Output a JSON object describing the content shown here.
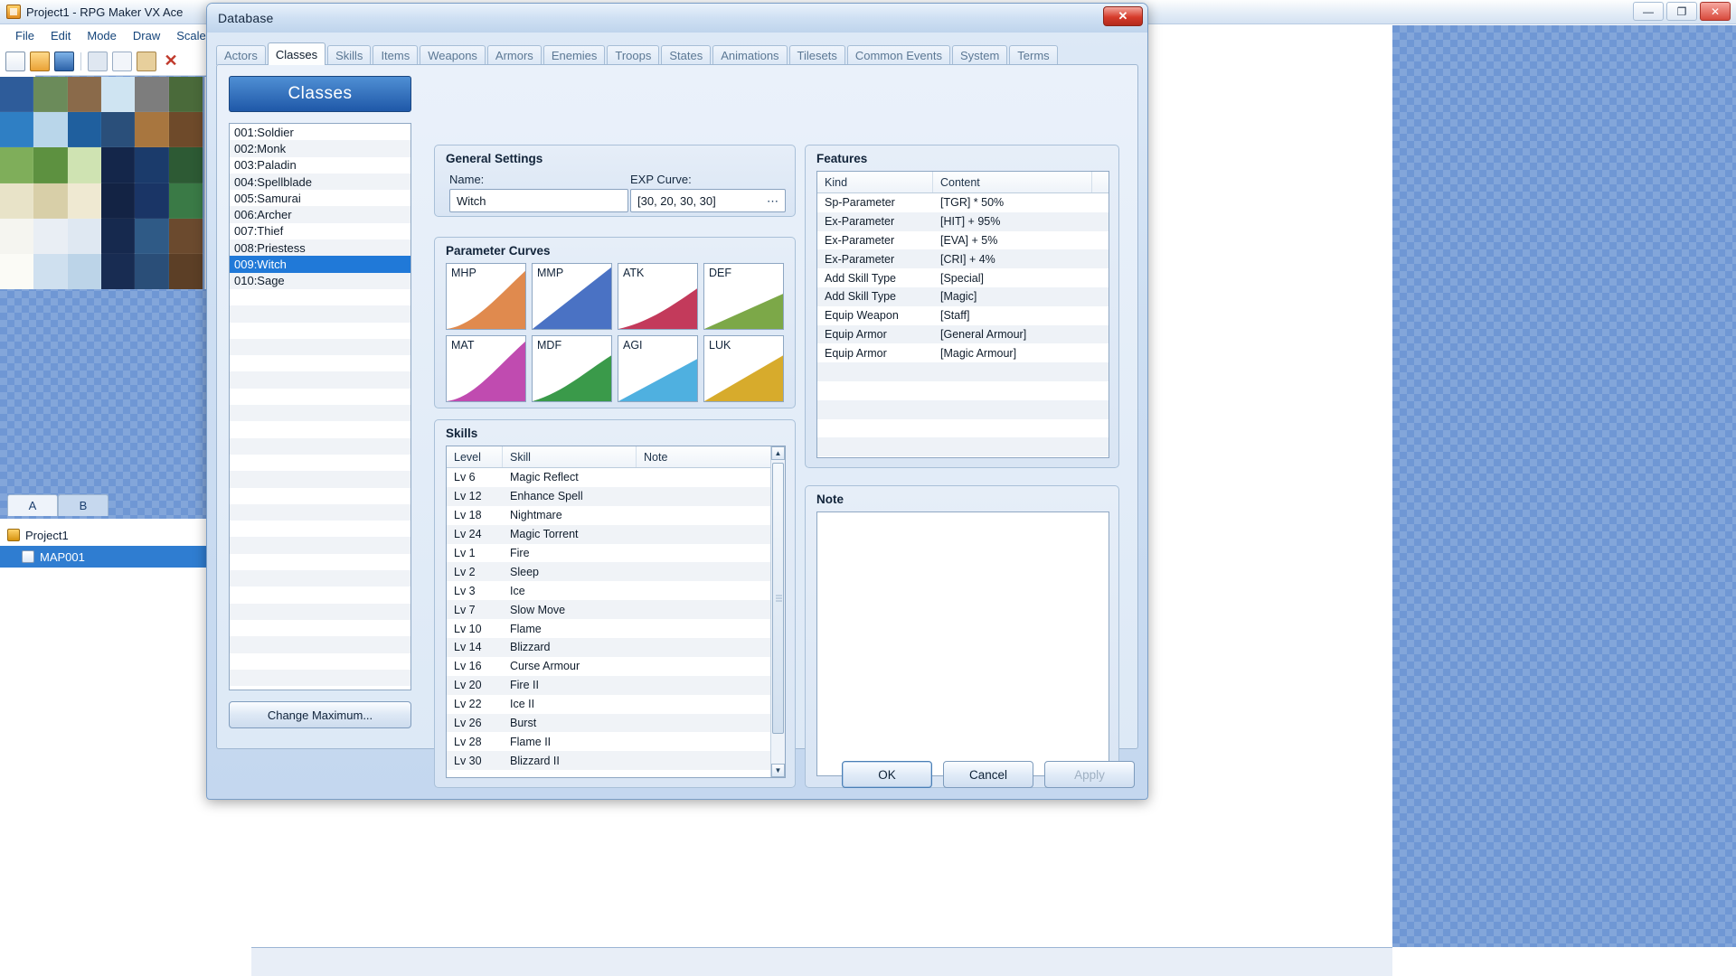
{
  "editor": {
    "title": "Project1 - RPG Maker VX Ace",
    "menu": [
      "File",
      "Edit",
      "Mode",
      "Draw",
      "Scale"
    ],
    "window_buttons": {
      "minimize": "—",
      "maximize": "❐",
      "close": "✕"
    },
    "layer_tabs": [
      {
        "label": "A",
        "active": false
      },
      {
        "label": "B",
        "active": true
      }
    ],
    "tree": [
      {
        "label": "Project1",
        "icon": "project-icon",
        "selected": false,
        "indent": false
      },
      {
        "label": "MAP001",
        "icon": "map-icon",
        "selected": true,
        "indent": true
      }
    ]
  },
  "dialog": {
    "title": "Database",
    "close_label": "✕",
    "tabs": [
      {
        "label": "Actors",
        "active": false
      },
      {
        "label": "Classes",
        "active": true
      },
      {
        "label": "Skills",
        "active": false
      },
      {
        "label": "Items",
        "active": false
      },
      {
        "label": "Weapons",
        "active": false
      },
      {
        "label": "Armors",
        "active": false
      },
      {
        "label": "Enemies",
        "active": false
      },
      {
        "label": "Troops",
        "active": false
      },
      {
        "label": "States",
        "active": false
      },
      {
        "label": "Animations",
        "active": false
      },
      {
        "label": "Tilesets",
        "active": false
      },
      {
        "label": "Common Events",
        "active": false
      },
      {
        "label": "System",
        "active": false
      },
      {
        "label": "Terms",
        "active": false
      }
    ],
    "buttons": {
      "ok": "OK",
      "cancel": "Cancel",
      "apply": "Apply"
    }
  },
  "classes_panel": {
    "header": "Classes",
    "change_maximum": "Change Maximum...",
    "items": [
      {
        "label": "001:Soldier",
        "selected": false
      },
      {
        "label": "002:Monk",
        "selected": false
      },
      {
        "label": "003:Paladin",
        "selected": false
      },
      {
        "label": "004:Spellblade",
        "selected": false
      },
      {
        "label": "005:Samurai",
        "selected": false
      },
      {
        "label": "006:Archer",
        "selected": false
      },
      {
        "label": "007:Thief",
        "selected": false
      },
      {
        "label": "008:Priestess",
        "selected": false
      },
      {
        "label": "009:Witch",
        "selected": true
      },
      {
        "label": "010:Sage",
        "selected": false
      }
    ]
  },
  "general_settings": {
    "title": "General Settings",
    "name_label": "Name:",
    "name_value": "Witch",
    "exp_curve_label": "EXP Curve:",
    "exp_curve_value": "[30, 20, 30, 30]",
    "exp_curve_button": "⋯"
  },
  "parameter_curves": {
    "title": "Parameter Curves",
    "curves": [
      {
        "label": "MHP",
        "color": "#e08a4e",
        "shape": "concave"
      },
      {
        "label": "MMP",
        "color": "#4a72c4",
        "shape": "linear"
      },
      {
        "label": "ATK",
        "color": "#c33a5b",
        "shape": "convex"
      },
      {
        "label": "DEF",
        "color": "#7ca848",
        "shape": "shallow"
      },
      {
        "label": "MAT",
        "color": "#c04bb0",
        "shape": "concave"
      },
      {
        "label": "MDF",
        "color": "#3a9a4a",
        "shape": "convex"
      },
      {
        "label": "AGI",
        "color": "#4fb0e0",
        "shape": "linear"
      },
      {
        "label": "LUK",
        "color": "#d7ab2c",
        "shape": "shallow"
      }
    ]
  },
  "skills": {
    "title": "Skills",
    "columns": [
      "Level",
      "Skill",
      "Note"
    ],
    "rows": [
      {
        "level": "Lv  6",
        "skill": "Magic Reflect",
        "note": ""
      },
      {
        "level": "Lv 12",
        "skill": "Enhance Spell",
        "note": ""
      },
      {
        "level": "Lv 18",
        "skill": "Nightmare",
        "note": ""
      },
      {
        "level": "Lv 24",
        "skill": "Magic Torrent",
        "note": ""
      },
      {
        "level": "Lv  1",
        "skill": "Fire",
        "note": ""
      },
      {
        "level": "Lv  2",
        "skill": "Sleep",
        "note": ""
      },
      {
        "level": "Lv  3",
        "skill": "Ice",
        "note": ""
      },
      {
        "level": "Lv  7",
        "skill": "Slow Move",
        "note": ""
      },
      {
        "level": "Lv 10",
        "skill": "Flame",
        "note": ""
      },
      {
        "level": "Lv 14",
        "skill": "Blizzard",
        "note": ""
      },
      {
        "level": "Lv 16",
        "skill": "Curse Armour",
        "note": ""
      },
      {
        "level": "Lv 20",
        "skill": "Fire II",
        "note": ""
      },
      {
        "level": "Lv 22",
        "skill": "Ice II",
        "note": ""
      },
      {
        "level": "Lv 26",
        "skill": "Burst",
        "note": ""
      },
      {
        "level": "Lv 28",
        "skill": "Flame II",
        "note": ""
      },
      {
        "level": "Lv 30",
        "skill": "Blizzard II",
        "note": ""
      }
    ]
  },
  "features": {
    "title": "Features",
    "columns": [
      "Kind",
      "Content"
    ],
    "rows": [
      {
        "kind": "Sp-Parameter",
        "content": "[TGR] * 50%"
      },
      {
        "kind": "Ex-Parameter",
        "content": "[HIT] + 95%"
      },
      {
        "kind": "Ex-Parameter",
        "content": "[EVA] + 5%"
      },
      {
        "kind": "Ex-Parameter",
        "content": "[CRI] + 4%"
      },
      {
        "kind": "Add Skill Type",
        "content": "[Special]"
      },
      {
        "kind": "Add Skill Type",
        "content": "[Magic]"
      },
      {
        "kind": "Equip Weapon",
        "content": "[Staff]"
      },
      {
        "kind": "Equip Armor",
        "content": "[General Armour]"
      },
      {
        "kind": "Equip Armor",
        "content": "[Magic Armour]"
      }
    ],
    "empty_rows": 9
  },
  "note": {
    "title": "Note",
    "value": ""
  }
}
